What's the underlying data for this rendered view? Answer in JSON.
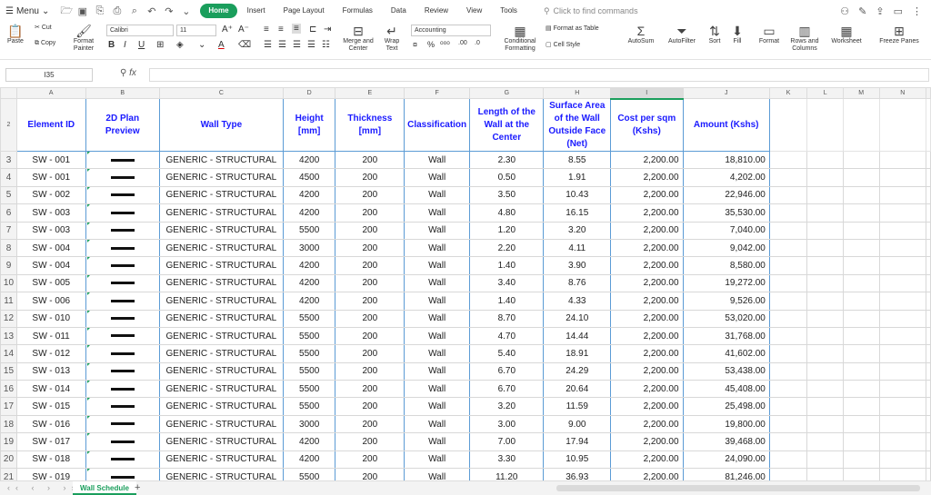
{
  "topbar": {
    "menu_label": "Menu",
    "tabs": [
      "Home",
      "Insert",
      "Page Layout",
      "Formulas",
      "Data",
      "Review",
      "View",
      "Tools"
    ],
    "find_placeholder": "Click to find commands"
  },
  "ribbon": {
    "paste": "Paste",
    "cut": "Cut",
    "copy": "Copy",
    "format_painter": "Format Painter",
    "font_name": "Calibri",
    "font_size": "11",
    "merge_center": "Merge and Center",
    "wrap_text": "Wrap Text",
    "number_format": "Accounting",
    "conditional_formatting": "Conditional Formatting",
    "format_as_table": "Format as Table",
    "cell_style": "Cell Style",
    "autosum": "AutoSum",
    "autofilter": "AutoFilter",
    "sort": "Sort",
    "fill": "Fill",
    "format": "Format",
    "rows_columns": "Rows and Columns",
    "worksheet": "Worksheet",
    "freeze_panes": "Freeze Panes"
  },
  "formula_bar": {
    "name_box": "I35",
    "fx": "fx",
    "content": ""
  },
  "columns": [
    "A",
    "B",
    "C",
    "D",
    "E",
    "F",
    "G",
    "H",
    "I",
    "J",
    "K",
    "L",
    "M",
    "N"
  ],
  "headers": [
    "Element ID",
    "2D Plan Preview",
    "Wall Type",
    "Height [mm]",
    "Thickness [mm]",
    "Classification",
    "Length of the Wall at the Center",
    "Surface Area of the Wall Outside Face (Net)",
    "Cost per sqm (Kshs)",
    "Amount (Kshs)"
  ],
  "rows": [
    {
      "n": "3",
      "id": "SW - 001",
      "type": "GENERIC - STRUCTURAL",
      "h": "4200",
      "t": "200",
      "cls": "Wall",
      "len": "2.30",
      "area": "8.55",
      "cost": "2,200.00",
      "amt": "18,810.00"
    },
    {
      "n": "4",
      "id": "SW - 001",
      "type": "GENERIC - STRUCTURAL",
      "h": "4500",
      "t": "200",
      "cls": "Wall",
      "len": "0.50",
      "area": "1.91",
      "cost": "2,200.00",
      "amt": "4,202.00"
    },
    {
      "n": "5",
      "id": "SW - 002",
      "type": "GENERIC - STRUCTURAL",
      "h": "4200",
      "t": "200",
      "cls": "Wall",
      "len": "3.50",
      "area": "10.43",
      "cost": "2,200.00",
      "amt": "22,946.00"
    },
    {
      "n": "6",
      "id": "SW - 003",
      "type": "GENERIC - STRUCTURAL",
      "h": "4200",
      "t": "200",
      "cls": "Wall",
      "len": "4.80",
      "area": "16.15",
      "cost": "2,200.00",
      "amt": "35,530.00"
    },
    {
      "n": "7",
      "id": "SW - 003",
      "type": "GENERIC - STRUCTURAL",
      "h": "5500",
      "t": "200",
      "cls": "Wall",
      "len": "1.20",
      "area": "3.20",
      "cost": "2,200.00",
      "amt": "7,040.00"
    },
    {
      "n": "8",
      "id": "SW - 004",
      "type": "GENERIC - STRUCTURAL",
      "h": "3000",
      "t": "200",
      "cls": "Wall",
      "len": "2.20",
      "area": "4.11",
      "cost": "2,200.00",
      "amt": "9,042.00"
    },
    {
      "n": "9",
      "id": "SW - 004",
      "type": "GENERIC - STRUCTURAL",
      "h": "4200",
      "t": "200",
      "cls": "Wall",
      "len": "1.40",
      "area": "3.90",
      "cost": "2,200.00",
      "amt": "8,580.00"
    },
    {
      "n": "10",
      "id": "SW - 005",
      "type": "GENERIC - STRUCTURAL",
      "h": "4200",
      "t": "200",
      "cls": "Wall",
      "len": "3.40",
      "area": "8.76",
      "cost": "2,200.00",
      "amt": "19,272.00"
    },
    {
      "n": "11",
      "id": "SW - 006",
      "type": "GENERIC - STRUCTURAL",
      "h": "4200",
      "t": "200",
      "cls": "Wall",
      "len": "1.40",
      "area": "4.33",
      "cost": "2,200.00",
      "amt": "9,526.00"
    },
    {
      "n": "12",
      "id": "SW - 010",
      "type": "GENERIC - STRUCTURAL",
      "h": "5500",
      "t": "200",
      "cls": "Wall",
      "len": "8.70",
      "area": "24.10",
      "cost": "2,200.00",
      "amt": "53,020.00"
    },
    {
      "n": "13",
      "id": "SW - 011",
      "type": "GENERIC - STRUCTURAL",
      "h": "5500",
      "t": "200",
      "cls": "Wall",
      "len": "4.70",
      "area": "14.44",
      "cost": "2,200.00",
      "amt": "31,768.00"
    },
    {
      "n": "14",
      "id": "SW - 012",
      "type": "GENERIC - STRUCTURAL",
      "h": "5500",
      "t": "200",
      "cls": "Wall",
      "len": "5.40",
      "area": "18.91",
      "cost": "2,200.00",
      "amt": "41,602.00"
    },
    {
      "n": "15",
      "id": "SW - 013",
      "type": "GENERIC - STRUCTURAL",
      "h": "5500",
      "t": "200",
      "cls": "Wall",
      "len": "6.70",
      "area": "24.29",
      "cost": "2,200.00",
      "amt": "53,438.00"
    },
    {
      "n": "16",
      "id": "SW - 014",
      "type": "GENERIC - STRUCTURAL",
      "h": "5500",
      "t": "200",
      "cls": "Wall",
      "len": "6.70",
      "area": "20.64",
      "cost": "2,200.00",
      "amt": "45,408.00"
    },
    {
      "n": "17",
      "id": "SW - 015",
      "type": "GENERIC - STRUCTURAL",
      "h": "5500",
      "t": "200",
      "cls": "Wall",
      "len": "3.20",
      "area": "11.59",
      "cost": "2,200.00",
      "amt": "25,498.00"
    },
    {
      "n": "18",
      "id": "SW - 016",
      "type": "GENERIC - STRUCTURAL",
      "h": "3000",
      "t": "200",
      "cls": "Wall",
      "len": "3.00",
      "area": "9.00",
      "cost": "2,200.00",
      "amt": "19,800.00"
    },
    {
      "n": "19",
      "id": "SW - 017",
      "type": "GENERIC - STRUCTURAL",
      "h": "4200",
      "t": "200",
      "cls": "Wall",
      "len": "7.00",
      "area": "17.94",
      "cost": "2,200.00",
      "amt": "39,468.00"
    },
    {
      "n": "20",
      "id": "SW - 018",
      "type": "GENERIC - STRUCTURAL",
      "h": "4200",
      "t": "200",
      "cls": "Wall",
      "len": "3.30",
      "area": "10.95",
      "cost": "2,200.00",
      "amt": "24,090.00"
    },
    {
      "n": "21",
      "id": "SW - 019",
      "type": "GENERIC - STRUCTURAL",
      "h": "5500",
      "t": "200",
      "cls": "Wall",
      "len": "11.20",
      "area": "36.93",
      "cost": "2,200.00",
      "amt": "81,246.00"
    }
  ],
  "sheet": {
    "tab_name": "Wall Schedule",
    "add_label": "+"
  }
}
